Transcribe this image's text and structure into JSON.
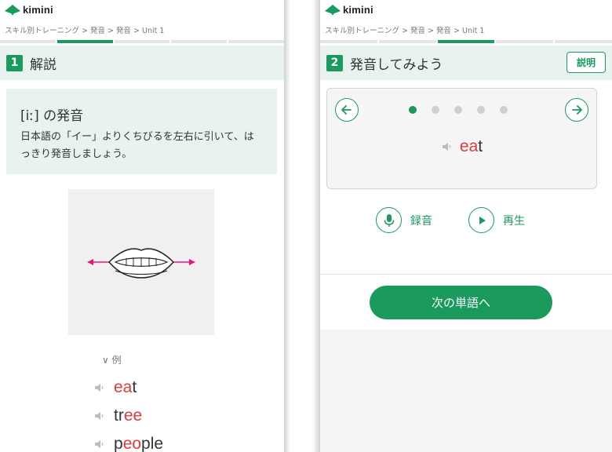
{
  "left": {
    "brand": "kimini",
    "breadcrumb": "スキル別トレーニング > 発音 > 発音 > Unit 1",
    "section_number": "1",
    "section_title": "解説",
    "info_title": "[iː] の発音",
    "info_text": "日本語の「イー」よりくちびるを左右に引いて、はっきり発音しましょう。",
    "examples_label": "∨ 例",
    "examples": [
      {
        "pre": "",
        "highlight": "ea",
        "post": "t"
      },
      {
        "pre": "tr",
        "highlight": "ee",
        "post": ""
      },
      {
        "pre": "p",
        "highlight": "eo",
        "post": "ple"
      }
    ]
  },
  "right": {
    "brand": "kimini",
    "breadcrumb": "スキル別トレーニング > 発音 > 発音 > Unit 1",
    "section_number": "2",
    "section_title": "発音してみよう",
    "explain_label": "説明",
    "current_index": 1,
    "total_words": 5,
    "word": {
      "pre": "",
      "highlight": "ea",
      "post": "t"
    },
    "record_label": "録音",
    "play_label": "再生",
    "next_label": "次の単語へ"
  },
  "colors": {
    "accent": "#1a9a5c",
    "highlight": "#e03a3a",
    "arrow": "#e8157a"
  }
}
